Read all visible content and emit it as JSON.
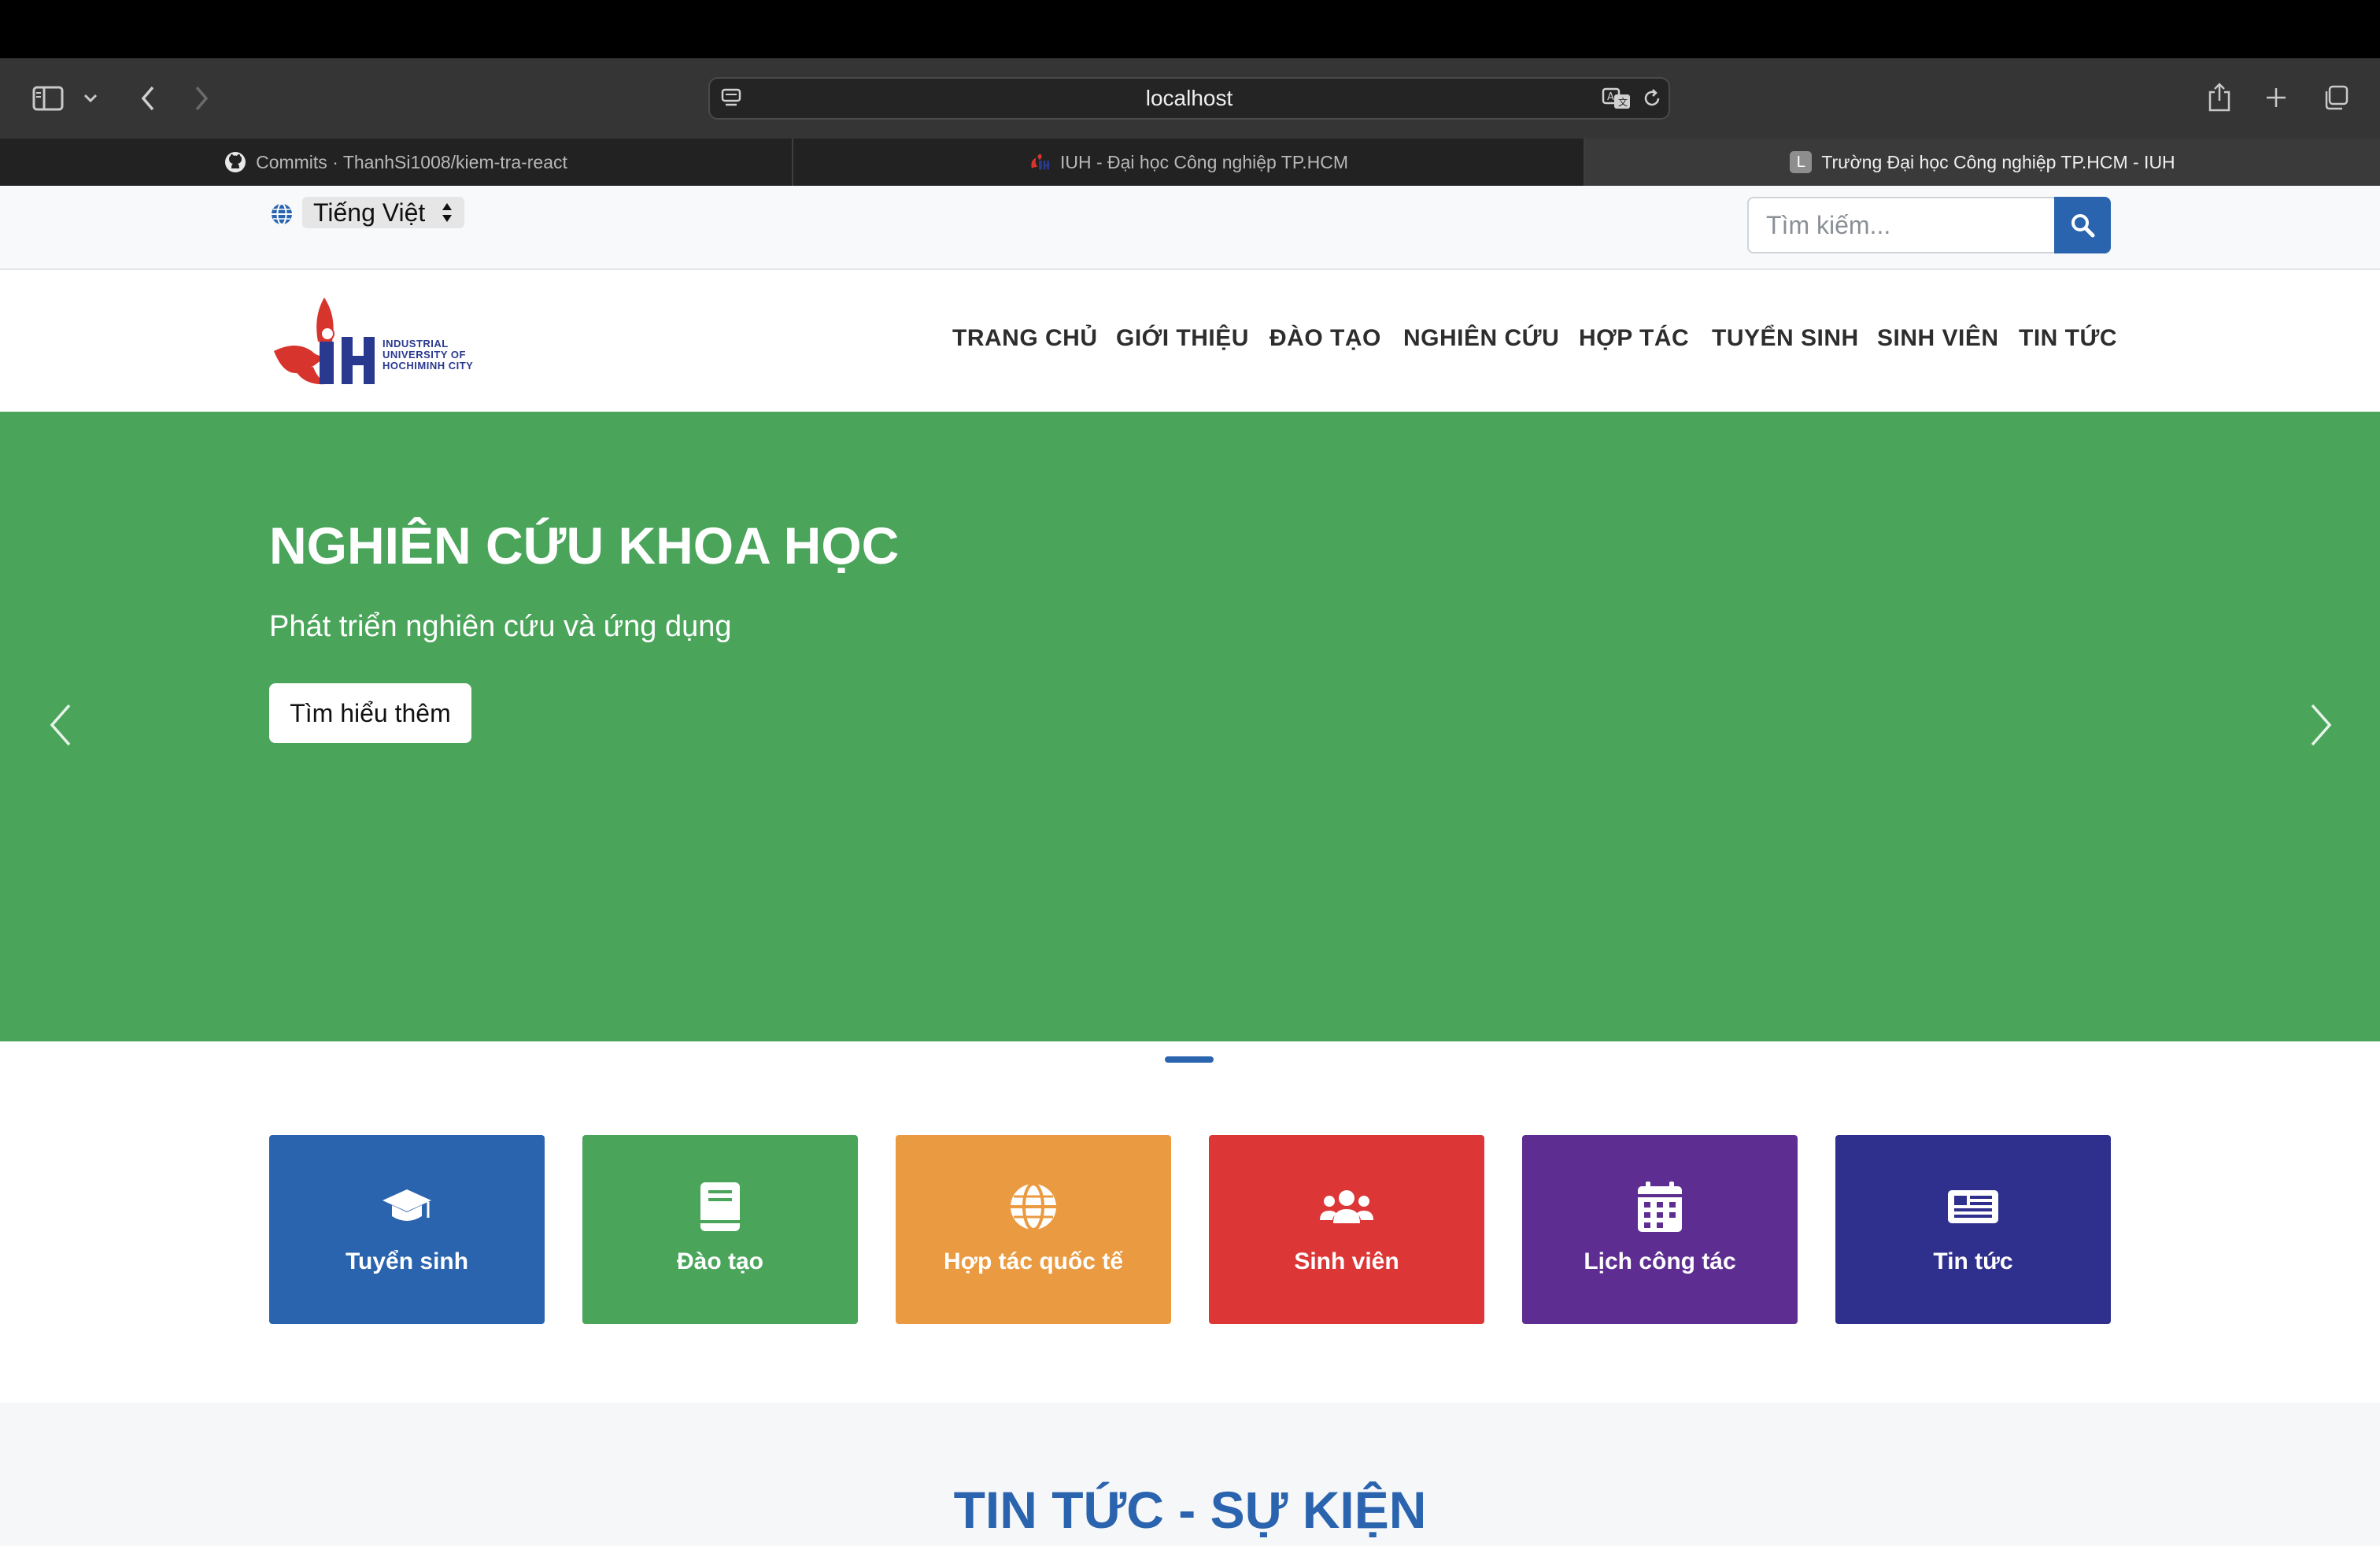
{
  "browser": {
    "url": "localhost",
    "tabs": [
      {
        "label": "Commits · ThanhSi1008/kiem-tra-react",
        "icon": "github-icon"
      },
      {
        "label": "IUH - Đại học Công nghiệp TP.HCM",
        "icon": "iuh-favicon"
      },
      {
        "label": "Trường Đại học Công nghiệp TP.HCM - IUH",
        "icon": "letter-L-favicon",
        "favicon_letter": "L",
        "active": true
      }
    ]
  },
  "site": {
    "language": "Tiếng Việt",
    "search_placeholder": "Tìm kiếm...",
    "logo_text": [
      "INDUSTRIAL",
      "UNIVERSITY OF",
      "HOCHIMINH CITY"
    ],
    "nav": [
      "TRANG CHỦ",
      "GIỚI THIỆU",
      "ĐÀO TẠO",
      "NGHIÊN CỨU",
      "HỢP TÁC",
      "TUYỂN SINH",
      "SINH VIÊN",
      "TIN TỨC"
    ],
    "hero": {
      "title": "NGHIÊN CỨU KHOA HỌC",
      "subtitle": "Phát triển nghiên cứu và ứng dụng",
      "button": "Tìm hiểu thêm",
      "background": "#4aa55b"
    },
    "tiles": [
      {
        "label": "Tuyển sinh",
        "icon": "graduation-cap-icon",
        "color": "#2a63ae"
      },
      {
        "label": "Đào tạo",
        "icon": "book-icon",
        "color": "#4aa55b"
      },
      {
        "label": "Hợp tác quốc tế",
        "icon": "globe-icon",
        "color": "#ea9a40"
      },
      {
        "label": "Sinh viên",
        "icon": "users-icon",
        "color": "#dc3636"
      },
      {
        "label": "Lịch công tác",
        "icon": "calendar-icon",
        "color": "#5e2d91"
      },
      {
        "label": "Tin tức",
        "icon": "newspaper-icon",
        "color": "#2f2f8e"
      }
    ],
    "news_title": "TIN TỨC - SỰ KIỆN"
  },
  "colors": {
    "accent": "#2a63ae",
    "hero_green": "#4aa55b"
  }
}
